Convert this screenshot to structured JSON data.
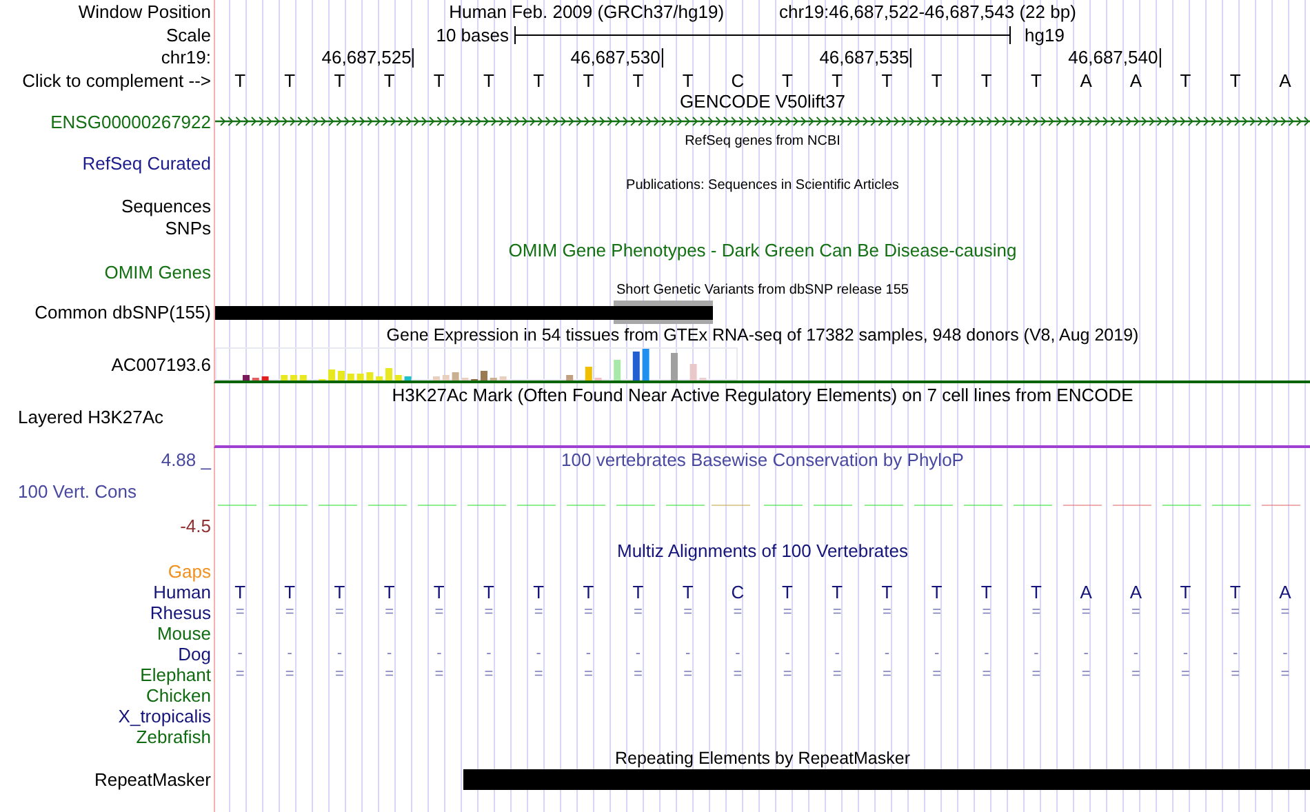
{
  "header": {
    "label": "Window Position",
    "assembly": "Human Feb. 2009 (GRCh37/hg19)",
    "position": "chr19:46,687,522-46,687,543 (22 bp)"
  },
  "scale": {
    "label": "Scale",
    "span": "10 bases",
    "db": "hg19"
  },
  "ruler": {
    "label": "chr19:",
    "ticks": [
      "46,687,525",
      "46,687,530",
      "46,687,535",
      "46,687,540"
    ]
  },
  "sequence": {
    "label": "Click to complement -->",
    "bases": [
      "T",
      "T",
      "T",
      "T",
      "T",
      "T",
      "T",
      "T",
      "T",
      "T",
      "C",
      "T",
      "T",
      "T",
      "T",
      "T",
      "T",
      "A",
      "A",
      "T",
      "T",
      "A"
    ]
  },
  "gencode": {
    "title": "GENCODE V50lift37",
    "label": "ENSG00000267922"
  },
  "refseq": {
    "title": "RefSeq genes from NCBI",
    "label": "RefSeq Curated"
  },
  "publications": {
    "title": "Publications: Sequences in Scientific Articles",
    "labels": [
      "Sequences",
      "SNPs"
    ]
  },
  "omim": {
    "title": "OMIM Gene Phenotypes - Dark Green Can Be Disease-causing",
    "label": "OMIM Genes"
  },
  "dbsnp": {
    "title": "Short Genetic Variants from dbSNP release 155",
    "label": "Common dbSNP(155)"
  },
  "gtex": {
    "title": "Gene Expression in 54 tissues from GTEx RNA-seq of 17382 samples, 948 donors (V8, Aug 2019)",
    "label": "AC007193.6"
  },
  "h3k27ac": {
    "title": "H3K27Ac Mark (Often Found Near Active Regulatory Elements) on 7 cell lines from ENCODE",
    "label": "Layered H3K27Ac"
  },
  "phylop": {
    "title": "100 vertebrates Basewise Conservation by PhyloP",
    "max": "4.88 _",
    "label": "100 Vert. Cons",
    "min": "-4.5"
  },
  "multiz": {
    "title": "Multiz Alignments of 100 Vertebrates",
    "rows": [
      {
        "species": "Gaps",
        "color": "#f0901e",
        "kind": "empty"
      },
      {
        "species": "Human",
        "color": "#14147a",
        "kind": "reference",
        "bases": [
          "T",
          "T",
          "T",
          "T",
          "T",
          "T",
          "T",
          "T",
          "T",
          "T",
          "C",
          "T",
          "T",
          "T",
          "T",
          "T",
          "T",
          "A",
          "A",
          "T",
          "T",
          "A"
        ]
      },
      {
        "species": "Rhesus",
        "color": "#14147a",
        "kind": "aligned",
        "bases": [
          "=",
          "=",
          "=",
          "=",
          "=",
          "=",
          "=",
          "=",
          "=",
          "=",
          "=",
          "=",
          "=",
          "=",
          "=",
          "=",
          "=",
          "=",
          "=",
          "=",
          "=",
          "="
        ]
      },
      {
        "species": "Mouse",
        "color": "#0f6b0f",
        "kind": "empty"
      },
      {
        "species": "Dog",
        "color": "#14147a",
        "kind": "aligned",
        "bases": [
          "-",
          "-",
          "-",
          "-",
          "-",
          "-",
          "-",
          "-",
          "-",
          "-",
          "-",
          "-",
          "-",
          "-",
          "-",
          "-",
          "-",
          "-",
          "-",
          "-",
          "-",
          "-"
        ]
      },
      {
        "species": "Elephant",
        "color": "#0f6b0f",
        "kind": "aligned",
        "bases": [
          "=",
          "=",
          "=",
          "=",
          "=",
          "=",
          "=",
          "=",
          "=",
          "=",
          "=",
          "=",
          "=",
          "=",
          "=",
          "=",
          "=",
          "=",
          "=",
          "=",
          "=",
          "="
        ]
      },
      {
        "species": "Chicken",
        "color": "#0f6b0f",
        "kind": "empty"
      },
      {
        "species": "X_tropicalis",
        "color": "#14147a",
        "kind": "empty"
      },
      {
        "species": "Zebrafish",
        "color": "#0f6b0f",
        "kind": "empty"
      }
    ]
  },
  "repeatmasker": {
    "title": "Repeating Elements by RepeatMasker",
    "label": "RepeatMasker"
  }
}
